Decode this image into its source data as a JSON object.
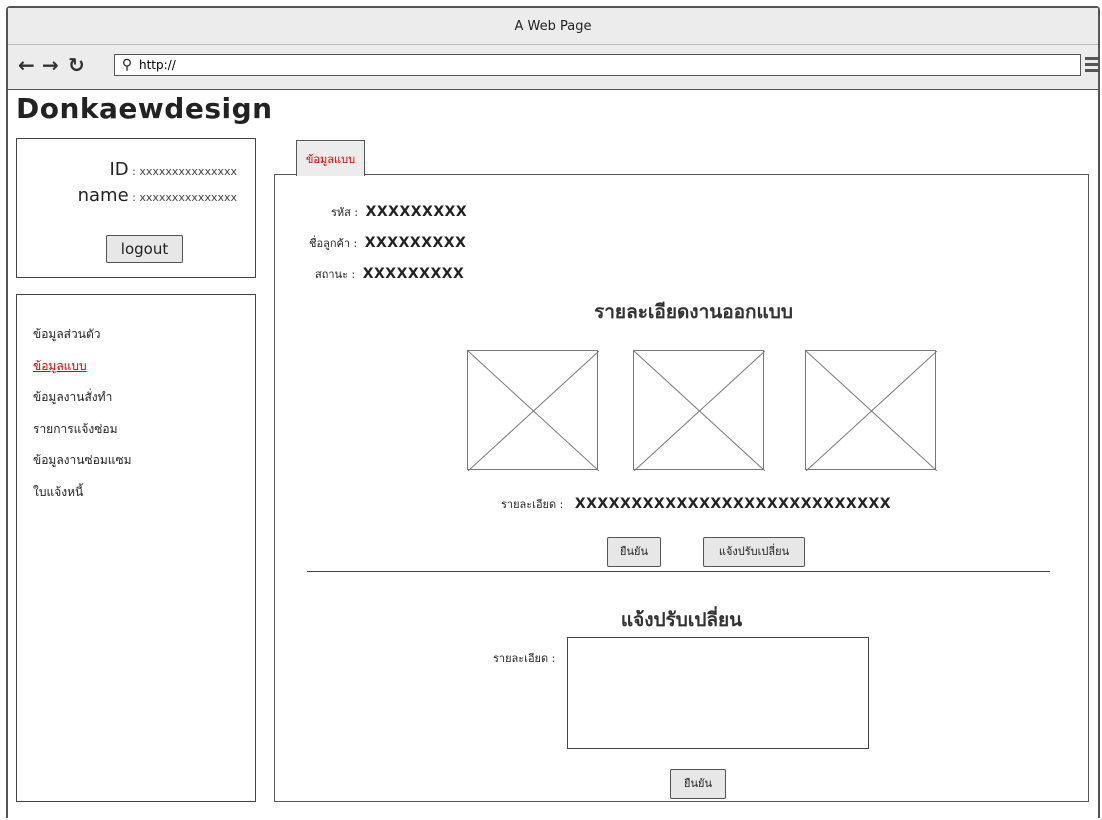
{
  "window": {
    "title": "A Web Page"
  },
  "browser": {
    "url": "http://"
  },
  "site": {
    "title": "Donkaewdesign"
  },
  "user": {
    "id_label": "ID",
    "id_value": "xxxxxxxxxxxxxxx",
    "name_label": "name",
    "name_value": "xxxxxxxxxxxxxxx",
    "logout_label": "logout"
  },
  "sidebar": {
    "items": [
      {
        "label": "ข้อมูลส่วนตัว",
        "active": false
      },
      {
        "label": "ข้อมูลแบบ",
        "active": true
      },
      {
        "label": "ข้อมูลงานสั่งทำ",
        "active": false
      },
      {
        "label": "รายการแจ้งซ่อม",
        "active": false
      },
      {
        "label": "ข้อมูลงานซ่อมแซม",
        "active": false
      },
      {
        "label": "ใบแจ้งหนี้",
        "active": false
      }
    ]
  },
  "tab": {
    "label": "ข้อมูลแบบ"
  },
  "info": {
    "code_label": "รหัส",
    "code_value": "XXXXXXXXX",
    "customer_label": "ชื่อลูกค้า",
    "customer_value": "XXXXXXXXX",
    "status_label": "สถานะ",
    "status_value": "XXXXXXXXX"
  },
  "design": {
    "heading": "รายละเอียดงานออกแบบ",
    "detail_label": "รายละเอียด",
    "detail_value": "XXXXXXXXXXXXXXXXXXXXXXXXXXXX",
    "confirm_label": "ยืนยัน",
    "request_change_label": "แจ้งปรับเปลี่ยน"
  },
  "change": {
    "heading": "แจ้งปรับเปลี่ยน",
    "detail_label": "รายละเอียด",
    "detail_value": "",
    "confirm_label": "ยืนยัน"
  }
}
